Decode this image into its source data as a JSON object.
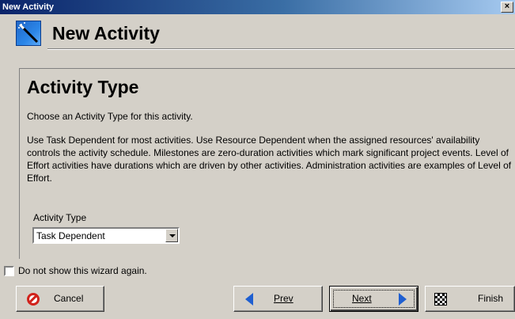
{
  "window": {
    "title": "New Activity",
    "close_glyph": "×"
  },
  "header": {
    "title": "New Activity",
    "icon": "magic-wand-icon"
  },
  "section": {
    "title": "Activity Type",
    "intro": "Choose an Activity Type for this activity.",
    "description": "Use Task Dependent for most activities.  Use Resource Dependent when the assigned resources' availability controls the activity schedule. Milestones are zero-duration activities which mark significant project events.  Level of Effort activities have durations which are driven by other activities.  Administration activities are examples of Level of Effort."
  },
  "activity_type": {
    "label": "Activity Type",
    "selected": "Task Dependent"
  },
  "checkbox": {
    "label": "Do not show this wizard again.",
    "checked": false
  },
  "buttons": {
    "cancel": "Cancel",
    "prev": "Prev",
    "next": "Next",
    "finish": "Finish"
  },
  "colors": {
    "titlebar": "#0a246a",
    "face": "#d4d0c8",
    "arrow": "#1f5fd1",
    "cancel_icon": "#d1221b"
  }
}
